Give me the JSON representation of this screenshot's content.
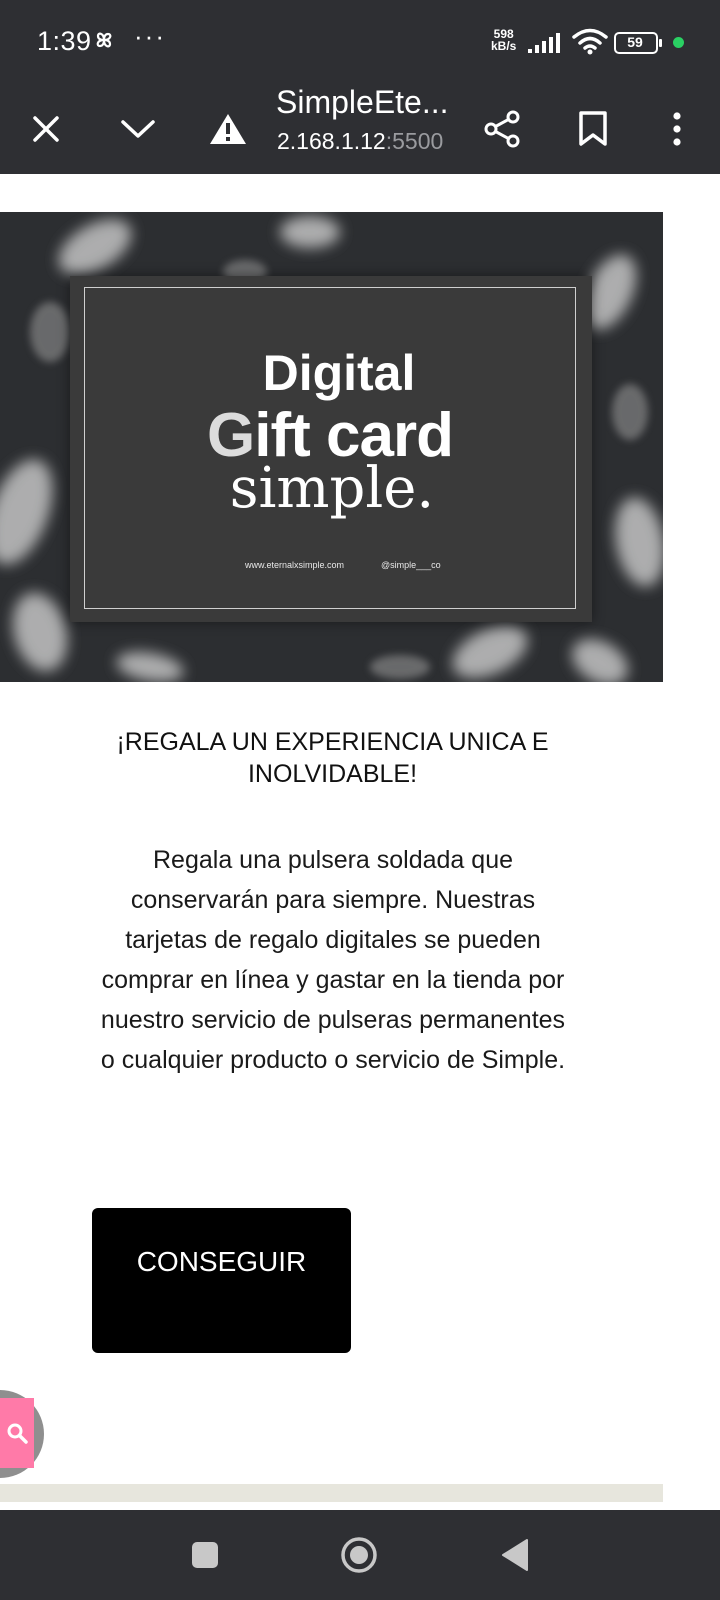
{
  "status_bar": {
    "time": "1:39",
    "more_dots": "···",
    "net_speed_value": "598",
    "net_speed_unit": "kB/s",
    "battery_level": "59"
  },
  "toolbar": {
    "page_title": "SimpleEte...",
    "url_host": "2.168.1.12",
    "url_port": ":5500"
  },
  "gift_card": {
    "line1": "Digital",
    "line2_initial": "G",
    "line2_rest": "ift card",
    "brand": "simple.",
    "website": "www.eternalxsimple.com",
    "handle": "@simple___co"
  },
  "content": {
    "headline": "¡REGALA UN EXPERIENCIA UNICA E INOLVIDABLE!",
    "description": "Regala una pulsera soldada que conservarán para siempre. Nuestras tarjetas de regalo digitales se pueden comprar en línea y gastar en la tienda por nuestro servicio de pulseras permanentes o cualquier producto o servicio de Simple.",
    "cta_label": "CONSEGUIR"
  },
  "colors": {
    "chrome_bg": "#2e2f33",
    "cta_bg": "#000000",
    "floating_button": "#ff7aa8",
    "notification_dot": "#2ad063"
  }
}
